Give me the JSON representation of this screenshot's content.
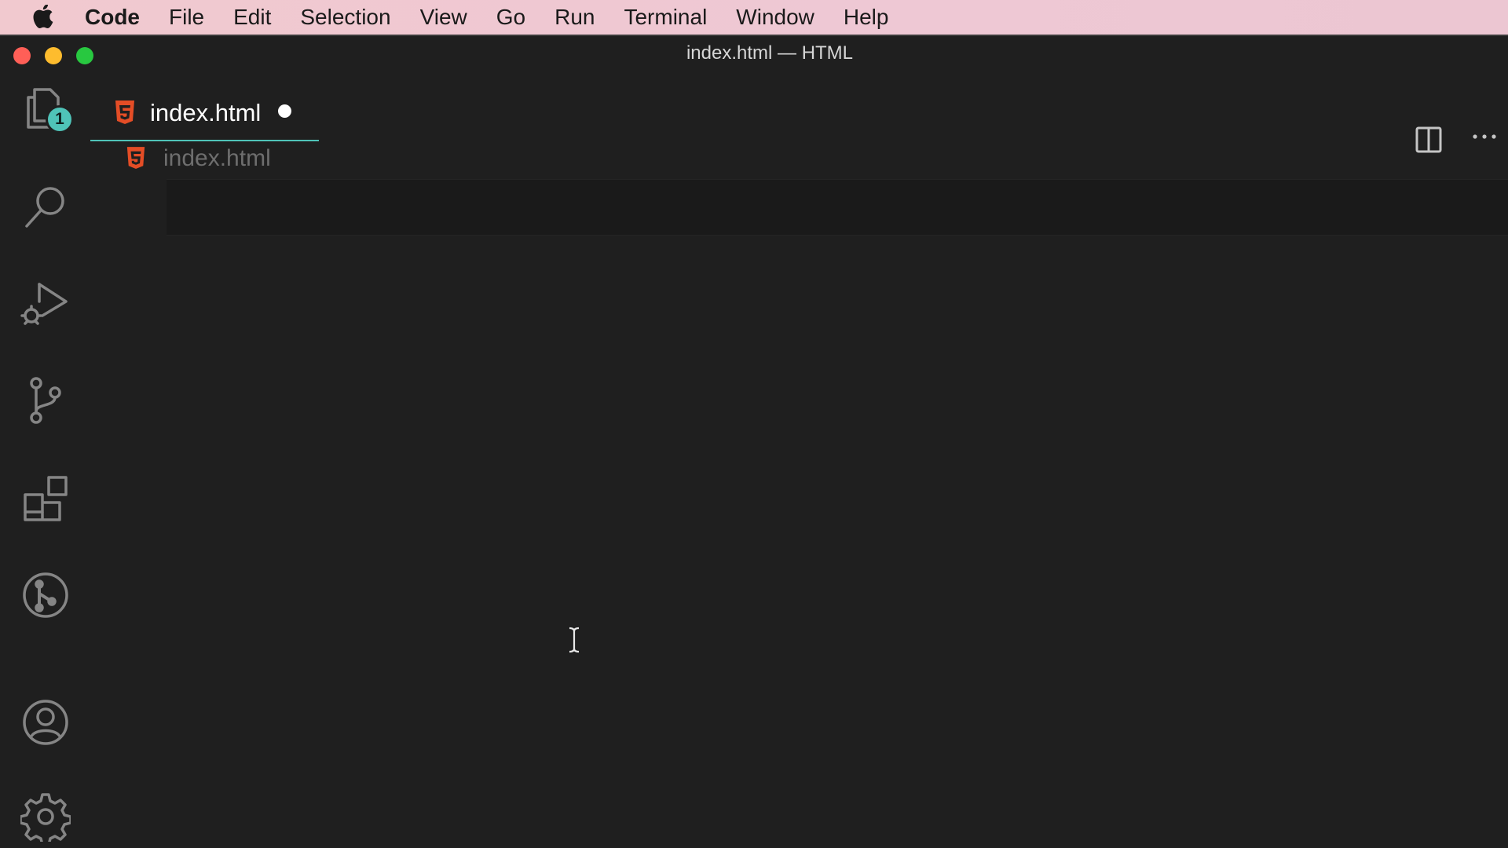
{
  "menubar": {
    "app_name": "Code",
    "items": [
      "File",
      "Edit",
      "Selection",
      "View",
      "Go",
      "Run",
      "Terminal",
      "Window",
      "Help"
    ]
  },
  "window": {
    "title": "index.html — HTML"
  },
  "activity_bar": {
    "explorer_badge": "1",
    "icons": [
      "files-icon",
      "search-icon",
      "run-debug-icon",
      "source-control-icon",
      "extensions-icon",
      "git-graph-icon",
      "account-icon",
      "settings-gear-icon"
    ]
  },
  "tabs": [
    {
      "label": "index.html",
      "icon": "html5-icon",
      "dirty": true
    }
  ],
  "breadcrumb": {
    "file": "index.html"
  },
  "colors": {
    "accent": "#4fc3b8",
    "html_icon": "#e44d26",
    "editor_bg": "#1f1f1f"
  }
}
